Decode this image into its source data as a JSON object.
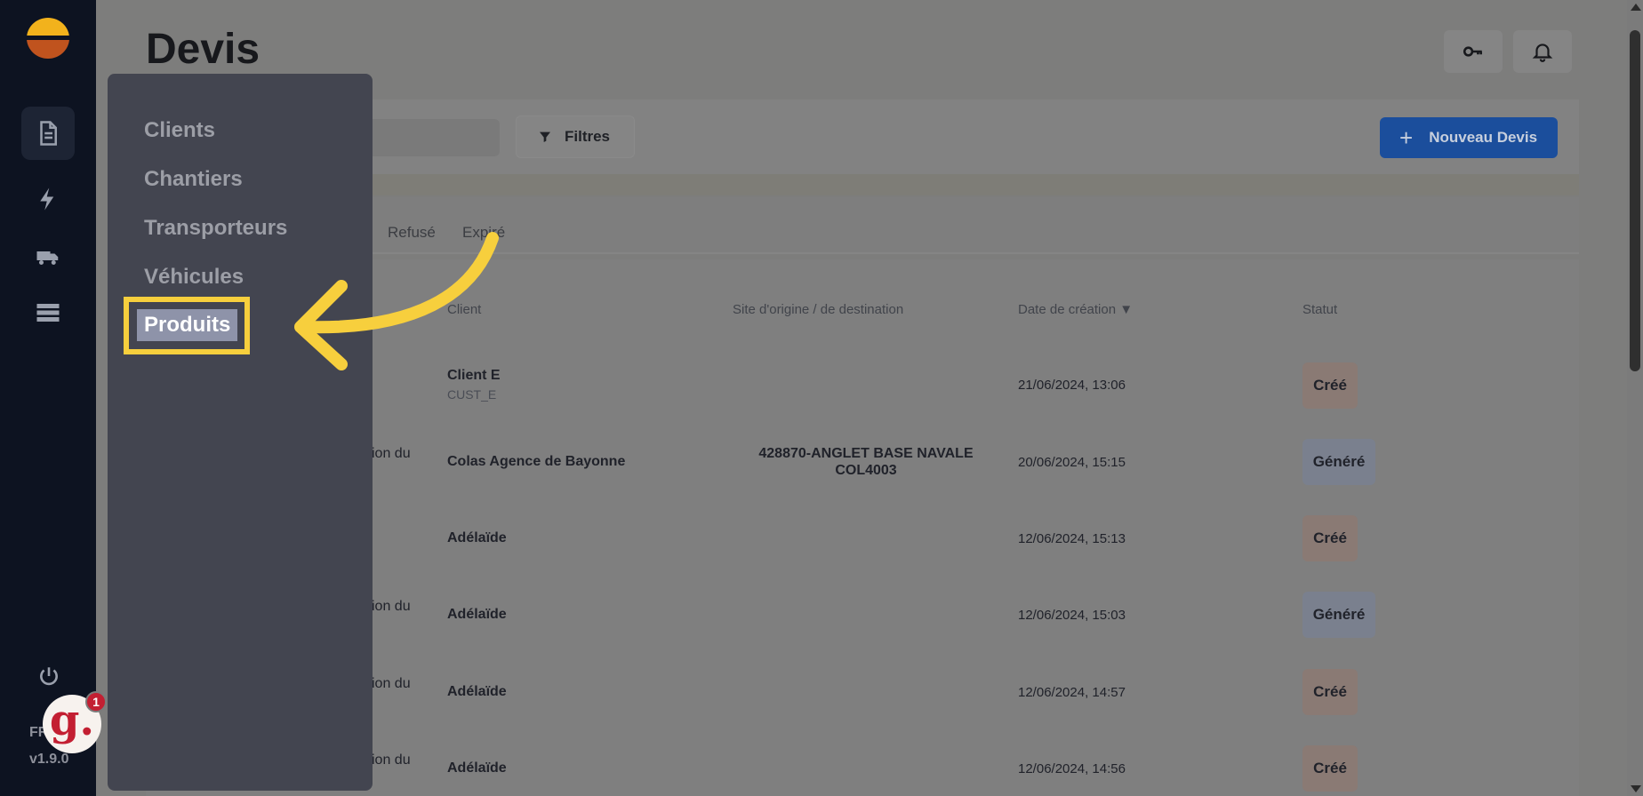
{
  "sidebar": {
    "nav_icons": [
      "document-icon",
      "lightning-icon",
      "truck-icon",
      "list-icon"
    ],
    "language": "FR",
    "version": "v1.9.0"
  },
  "header": {
    "title": "Devis"
  },
  "toolbar": {
    "filter_label": "Filtres",
    "new_button_label": "Nouveau Devis"
  },
  "tabs": {
    "refuse": "Refusé",
    "expire": "Expiré"
  },
  "table": {
    "headers": {
      "client": "Client",
      "site": "Site d'origine / de destination",
      "date": "Date de création ▼",
      "status": "Statut"
    },
    "rows": [
      {
        "left_fragment": "",
        "client": "Client E",
        "client_code": "CUST_E",
        "site_line1": "",
        "site_line2": "",
        "date": "21/06/2024, 13:06",
        "status": "Créé",
        "status_kind": "cree"
      },
      {
        "left_fragment": "ion du",
        "client": "Colas Agence de Bayonne",
        "client_code": "",
        "site_line1": "428870-ANGLET BASE NAVALE",
        "site_line2": "COL4003",
        "date": "20/06/2024, 15:15",
        "status": "Généré",
        "status_kind": "genere"
      },
      {
        "left_fragment": "",
        "client": "Adélaïde",
        "client_code": "",
        "site_line1": "",
        "site_line2": "",
        "date": "12/06/2024, 15:13",
        "status": "Créé",
        "status_kind": "cree"
      },
      {
        "left_fragment": "ion du",
        "client": "Adélaïde",
        "client_code": "",
        "site_line1": "",
        "site_line2": "",
        "date": "12/06/2024, 15:03",
        "status": "Généré",
        "status_kind": "genere"
      },
      {
        "left_fragment": "ion du",
        "client": "Adélaïde",
        "client_code": "",
        "site_line1": "",
        "site_line2": "",
        "date": "12/06/2024, 14:57",
        "status": "Créé",
        "status_kind": "cree"
      },
      {
        "left_fragment": "ion du",
        "client": "Adélaïde",
        "client_code": "",
        "site_line1": "",
        "site_line2": "",
        "date": "12/06/2024, 14:56",
        "status": "Créé",
        "status_kind": "cree"
      }
    ]
  },
  "menu": {
    "items": [
      "Clients",
      "Chantiers",
      "Transporteurs",
      "Véhicules",
      "Produits"
    ],
    "highlighted": "Produits"
  },
  "guide": {
    "letter": "g.",
    "badge": "1"
  },
  "colors": {
    "sidebar_bg": "#0d1321",
    "menu_bg": "#434550",
    "highlight": "#f7cf3d",
    "primary_button": "#1b4e9c"
  }
}
